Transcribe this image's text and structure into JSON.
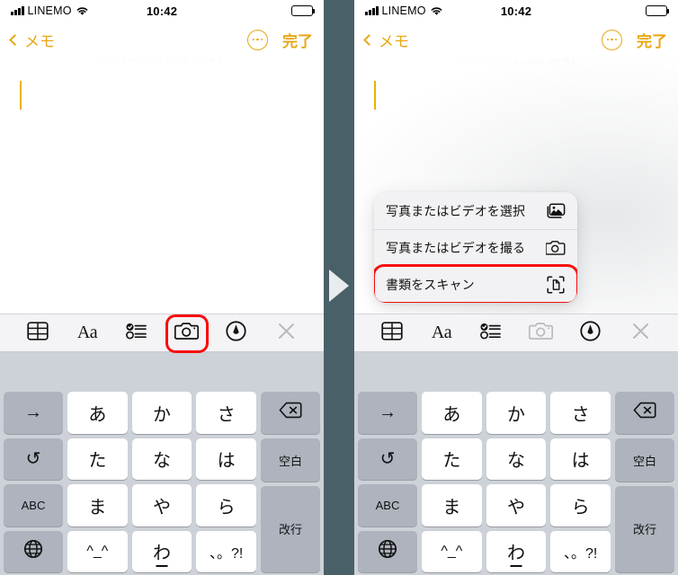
{
  "meta": {
    "app": "iOS Notes (メモ)",
    "colors": {
      "accent_yellow": "#e8a712",
      "highlight_red": "#f80e0e",
      "divider_bg": "#4a6068",
      "keyboard_bg": "#cdd1d8",
      "toolbar_bg": "#f4f4f6",
      "menu_bg": "#f2f2f4"
    }
  },
  "statusbar": {
    "carrier": "LINEMO",
    "time": "10:42",
    "signal_icon": "cellular-signal-icon",
    "wifi_icon": "wifi-icon",
    "battery_icon": "battery-icon"
  },
  "navbar": {
    "back_label": "メモ",
    "back_icon": "chevron-left-icon",
    "more_icon": "more-ellipsis-circle-icon",
    "done_label": "完了"
  },
  "note": {
    "date_text": "2022年10月30日 10:41",
    "cursor": "text-caret"
  },
  "menu": {
    "items": [
      {
        "label": "写真またはビデオを選択",
        "icon": "photo-library-icon",
        "highlighted": false
      },
      {
        "label": "写真またはビデオを撮る",
        "icon": "camera-icon",
        "highlighted": false
      },
      {
        "label": "書類をスキャン",
        "icon": "document-scan-icon",
        "highlighted": true
      }
    ]
  },
  "toolbar": {
    "items": [
      {
        "name": "table-icon",
        "label": "",
        "type": "table"
      },
      {
        "name": "text-format-icon",
        "label": "Aa",
        "type": "aa"
      },
      {
        "name": "checklist-icon",
        "label": "",
        "type": "checklist"
      },
      {
        "name": "camera-icon",
        "label": "",
        "type": "camera"
      },
      {
        "name": "markup-pen-icon",
        "label": "",
        "type": "markup"
      },
      {
        "name": "close-icon",
        "label": "",
        "type": "close"
      }
    ]
  },
  "keyboard": {
    "left_column": [
      {
        "label": "→",
        "name": "key-arrow-right"
      },
      {
        "label": "↺",
        "name": "key-undo"
      },
      {
        "label": "ABC",
        "name": "key-abc"
      },
      {
        "label": "",
        "name": "key-globe"
      }
    ],
    "center_rows": [
      [
        "あ",
        "か",
        "さ"
      ],
      [
        "た",
        "な",
        "は"
      ],
      [
        "ま",
        "や",
        "ら"
      ],
      [
        "^_^",
        "わ",
        "、。?!"
      ]
    ],
    "right_column": [
      {
        "label": "",
        "name": "key-delete"
      },
      {
        "label": "空白",
        "name": "key-space"
      },
      {
        "label": "改行",
        "name": "key-return"
      }
    ]
  },
  "annotation": {
    "arrow": "step-arrow-right",
    "red_box_toolbar": "camera-button-highlight",
    "red_box_menu": "scan-document-highlight"
  }
}
